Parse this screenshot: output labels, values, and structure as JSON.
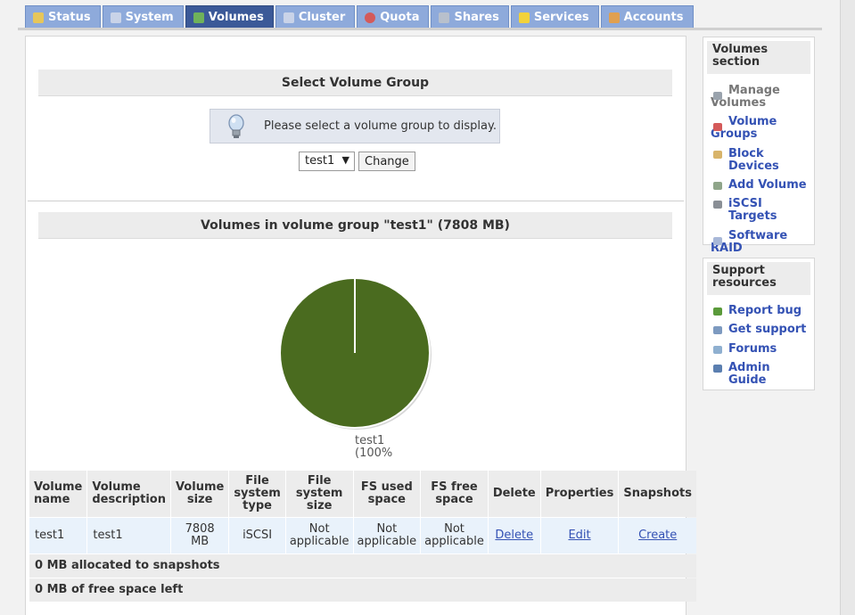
{
  "tabs": [
    {
      "label": "Status",
      "icon": "status-icon",
      "color": "#e7c65a"
    },
    {
      "label": "System",
      "icon": "system-icon",
      "color": "#c9d3e8"
    },
    {
      "label": "Volumes",
      "icon": "volumes-icon",
      "color": "#6fb25a",
      "active": true
    },
    {
      "label": "Cluster",
      "icon": "cluster-icon",
      "color": "#c9d3e8"
    },
    {
      "label": "Quota",
      "icon": "quota-icon",
      "color": "#d45a5a"
    },
    {
      "label": "Shares",
      "icon": "shares-icon",
      "color": "#b8c0cc"
    },
    {
      "label": "Services",
      "icon": "services-icon",
      "color": "#f2d23a"
    },
    {
      "label": "Accounts",
      "icon": "accounts-icon",
      "color": "#e0a050"
    }
  ],
  "select_group": {
    "heading": "Select Volume Group",
    "info": "Please select a volume group to display.",
    "selected": "test1",
    "arrow": "▼",
    "button": "Change"
  },
  "volumes": {
    "heading": "Volumes in volume group \"test1\" (7808 MB)",
    "columns": [
      "Volume name",
      "Volume description",
      "Volume size",
      "File system type",
      "File system size",
      "FS used space",
      "FS free space",
      "Delete",
      "Properties",
      "Snapshots"
    ],
    "rows": [
      {
        "name": "test1",
        "description": "test1",
        "size": "7808 MB",
        "fs_type": "iSCSI",
        "fs_size": "Not applicable",
        "fs_used": "Not applicable",
        "fs_free": "Not applicable",
        "delete": "Delete",
        "properties": "Edit",
        "snapshots": "Create"
      }
    ],
    "snapshots_summary": "0 MB allocated to snapshots",
    "free_summary": "0 MB of free space left"
  },
  "chart_data": {
    "type": "pie",
    "slices": [
      {
        "label": "test1",
        "value": 100
      }
    ],
    "label_line1": "test1",
    "label_line2": "(100%",
    "color": "#4a6b1f"
  },
  "sidebar": {
    "volumes_section": {
      "title": "Volumes section",
      "items": [
        {
          "label": "Manage Volumes",
          "icon": "manage-volumes-icon",
          "disabled": true
        },
        {
          "label": "Volume Groups",
          "icon": "volume-groups-icon"
        },
        {
          "label": "Block Devices",
          "icon": "block-devices-icon"
        },
        {
          "label": "Add Volume",
          "icon": "add-volume-icon"
        },
        {
          "label": "iSCSI Targets",
          "icon": "iscsi-targets-icon"
        },
        {
          "label": "Software RAID",
          "icon": "software-raid-icon"
        }
      ]
    },
    "support": {
      "title": "Support resources",
      "items": [
        {
          "label": "Report bug",
          "icon": "report-bug-icon"
        },
        {
          "label": "Get support",
          "icon": "get-support-icon"
        },
        {
          "label": "Forums",
          "icon": "forums-icon"
        },
        {
          "label": "Admin Guide",
          "icon": "admin-guide-icon"
        }
      ]
    }
  }
}
